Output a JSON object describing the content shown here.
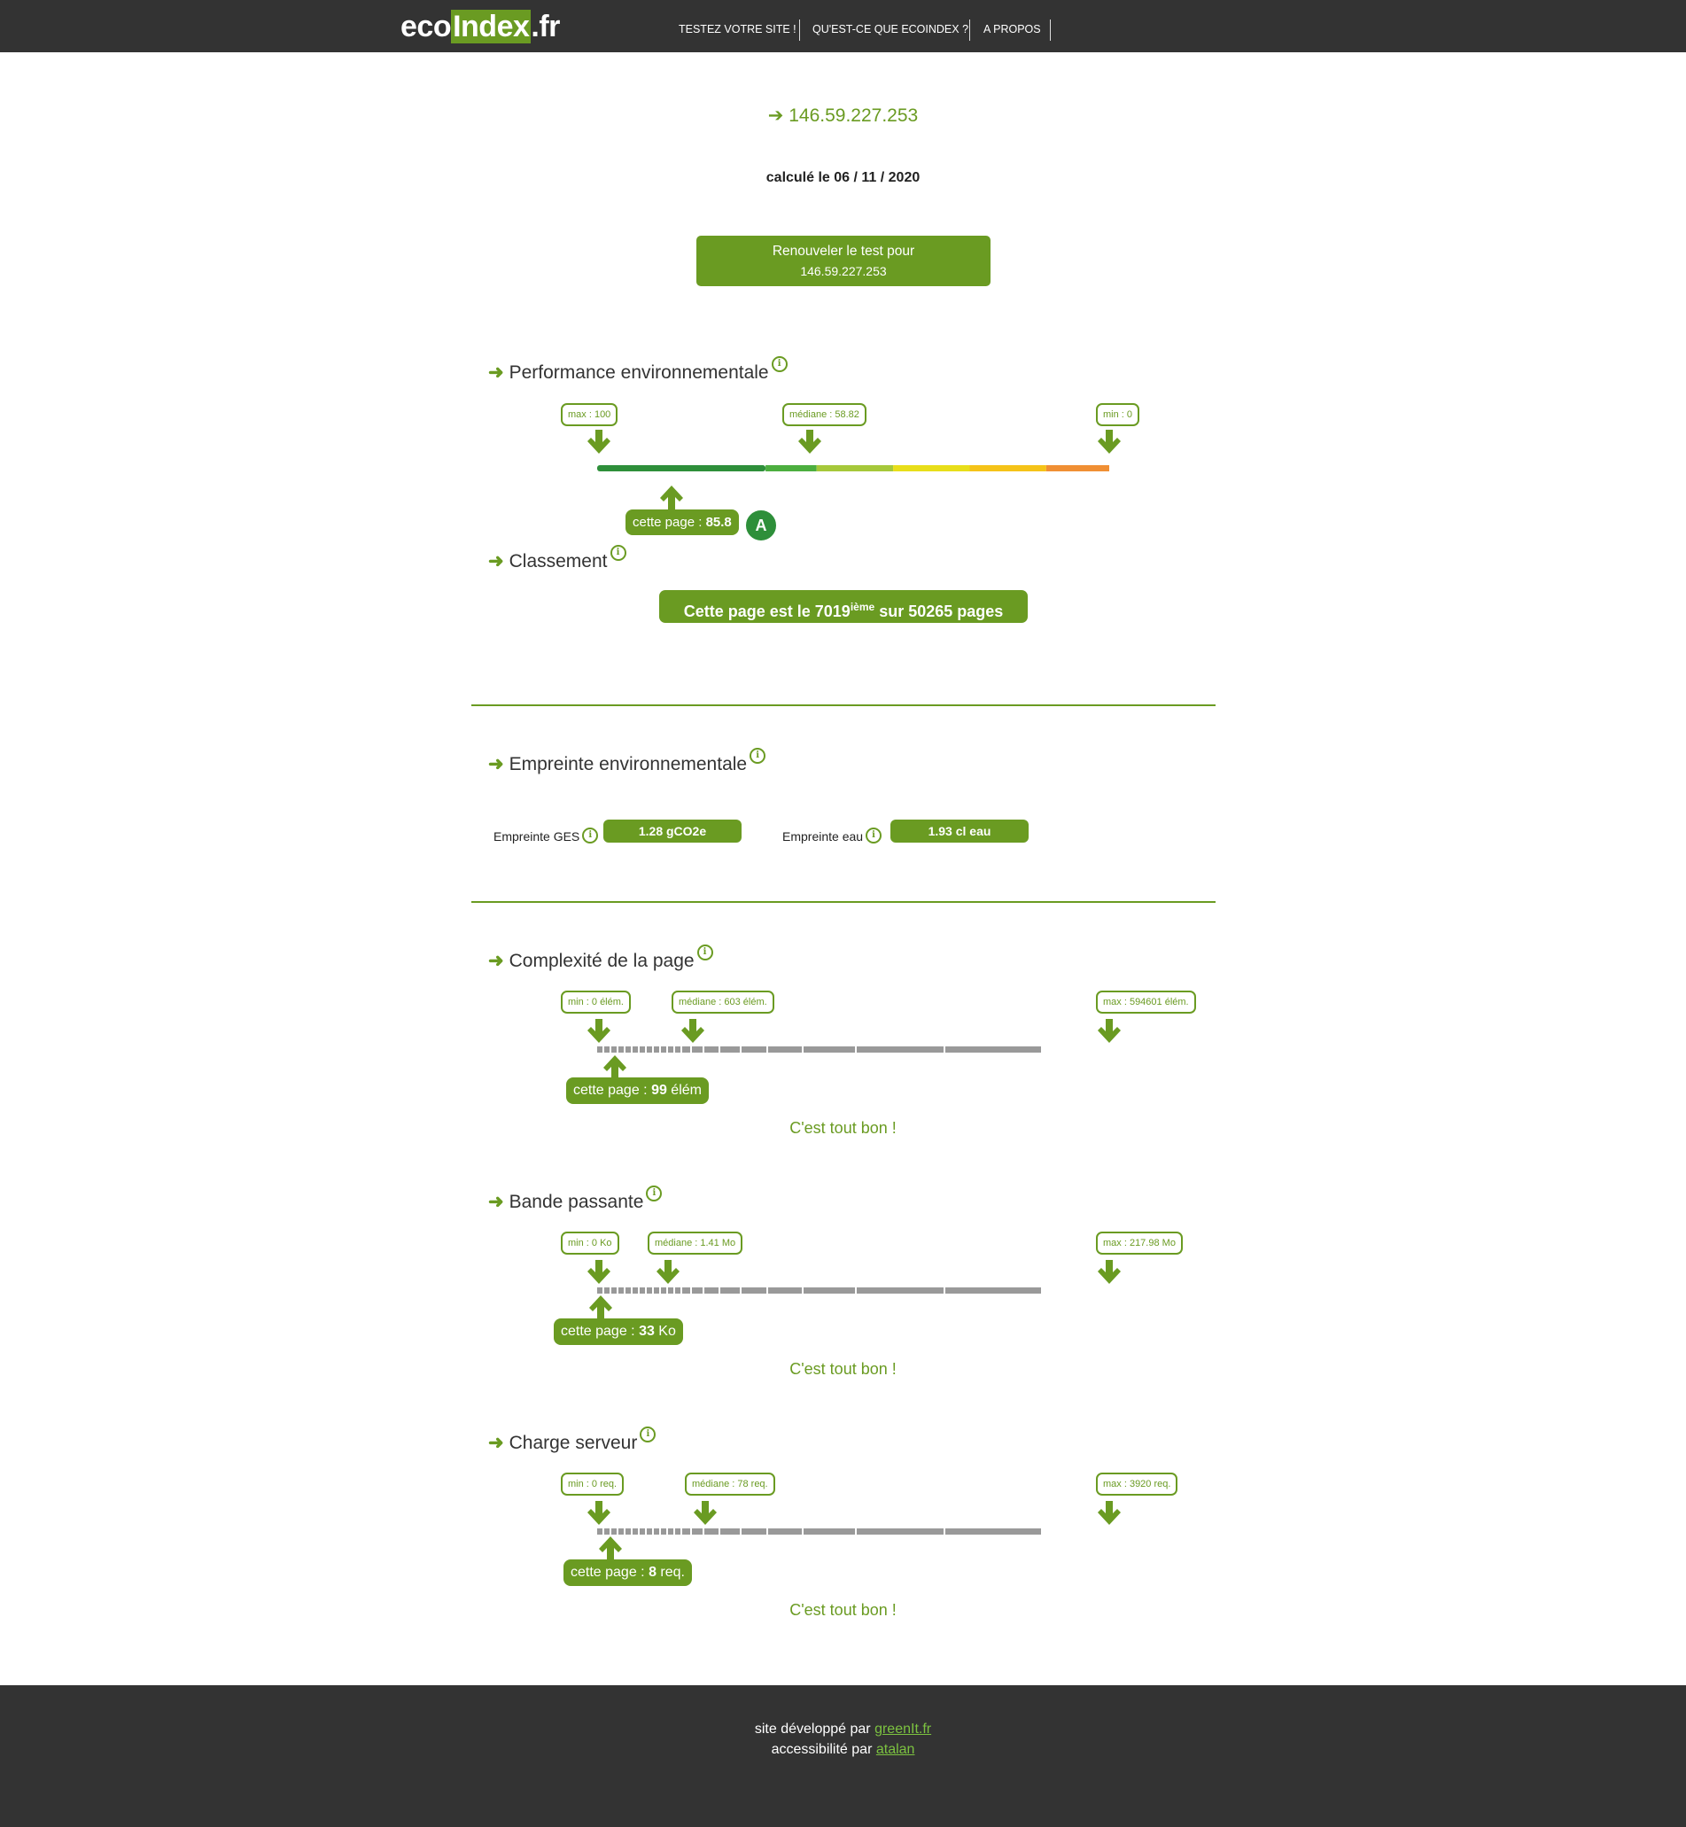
{
  "header": {
    "logo_eco": "eco",
    "logo_index": "Index",
    "logo_tld": ".fr",
    "nav": [
      {
        "label": "TESTEZ VOTRE SITE !"
      },
      {
        "label": "QU'EST-CE QUE ECOINDEX ?"
      },
      {
        "label": "A PROPOS"
      }
    ]
  },
  "intro": {
    "url_arrow": "➔",
    "url": "146.59.227.253",
    "date_text": "calculé le 06 / 11 / 2020",
    "renew_line1": "Renouveler le test pour",
    "renew_line2": "146.59.227.253"
  },
  "performance": {
    "title": "Performance environnementale",
    "max_tag": "max : 100",
    "median_tag": "médiane : 58.82",
    "min_tag": "min : 0",
    "page_label": "cette page : ",
    "page_value": "85.8",
    "grade": "A",
    "score": 85.8
  },
  "ranking": {
    "title": "Classement",
    "text_before": "Cette page est le 7019",
    "sup": "ième",
    "text_after": " sur 50265 pages"
  },
  "footprint": {
    "title": "Empreinte environnementale",
    "ges_label": "Empreinte GES",
    "ges_value": "1.28 gCO2e",
    "water_label": "Empreinte eau",
    "water_value": "1.93 cl eau"
  },
  "complexity": {
    "title": "Complexité de la page",
    "min_tag": "min : 0 élém.",
    "median_tag": "médiane : 603 élém.",
    "max_tag": "max : 594601 élém.",
    "page_label": "cette page : ",
    "page_value": "99",
    "page_unit": " élém",
    "ok": "C'est tout bon !"
  },
  "bandwidth": {
    "title": "Bande passante",
    "min_tag": "min : 0 Ko",
    "median_tag": "médiane : 1.41 Mo",
    "max_tag": "max : 217.98 Mo",
    "page_label": "cette page : ",
    "page_value": "33",
    "page_unit": " Ko",
    "ok": "C'est tout bon !"
  },
  "server": {
    "title": "Charge serveur",
    "min_tag": "min : 0 req.",
    "median_tag": "médiane : 78 req.",
    "max_tag": "max : 3920 req.",
    "page_label": "cette page : ",
    "page_value": "8",
    "page_unit": " req.",
    "ok": "C'est tout bon !"
  },
  "footer": {
    "line1_prefix": "site développé par ",
    "line1_link": "greenIt.fr",
    "line2_prefix": "accessibilité par ",
    "line2_link": "atalan"
  },
  "colors": {
    "accent": "#6a9b22",
    "header_bg": "#333333",
    "scale": [
      "#2e8f3a",
      "#4cae3f",
      "#a6c83a",
      "#e8de1a",
      "#f5c318",
      "#f08f34",
      "#e32b22"
    ]
  }
}
